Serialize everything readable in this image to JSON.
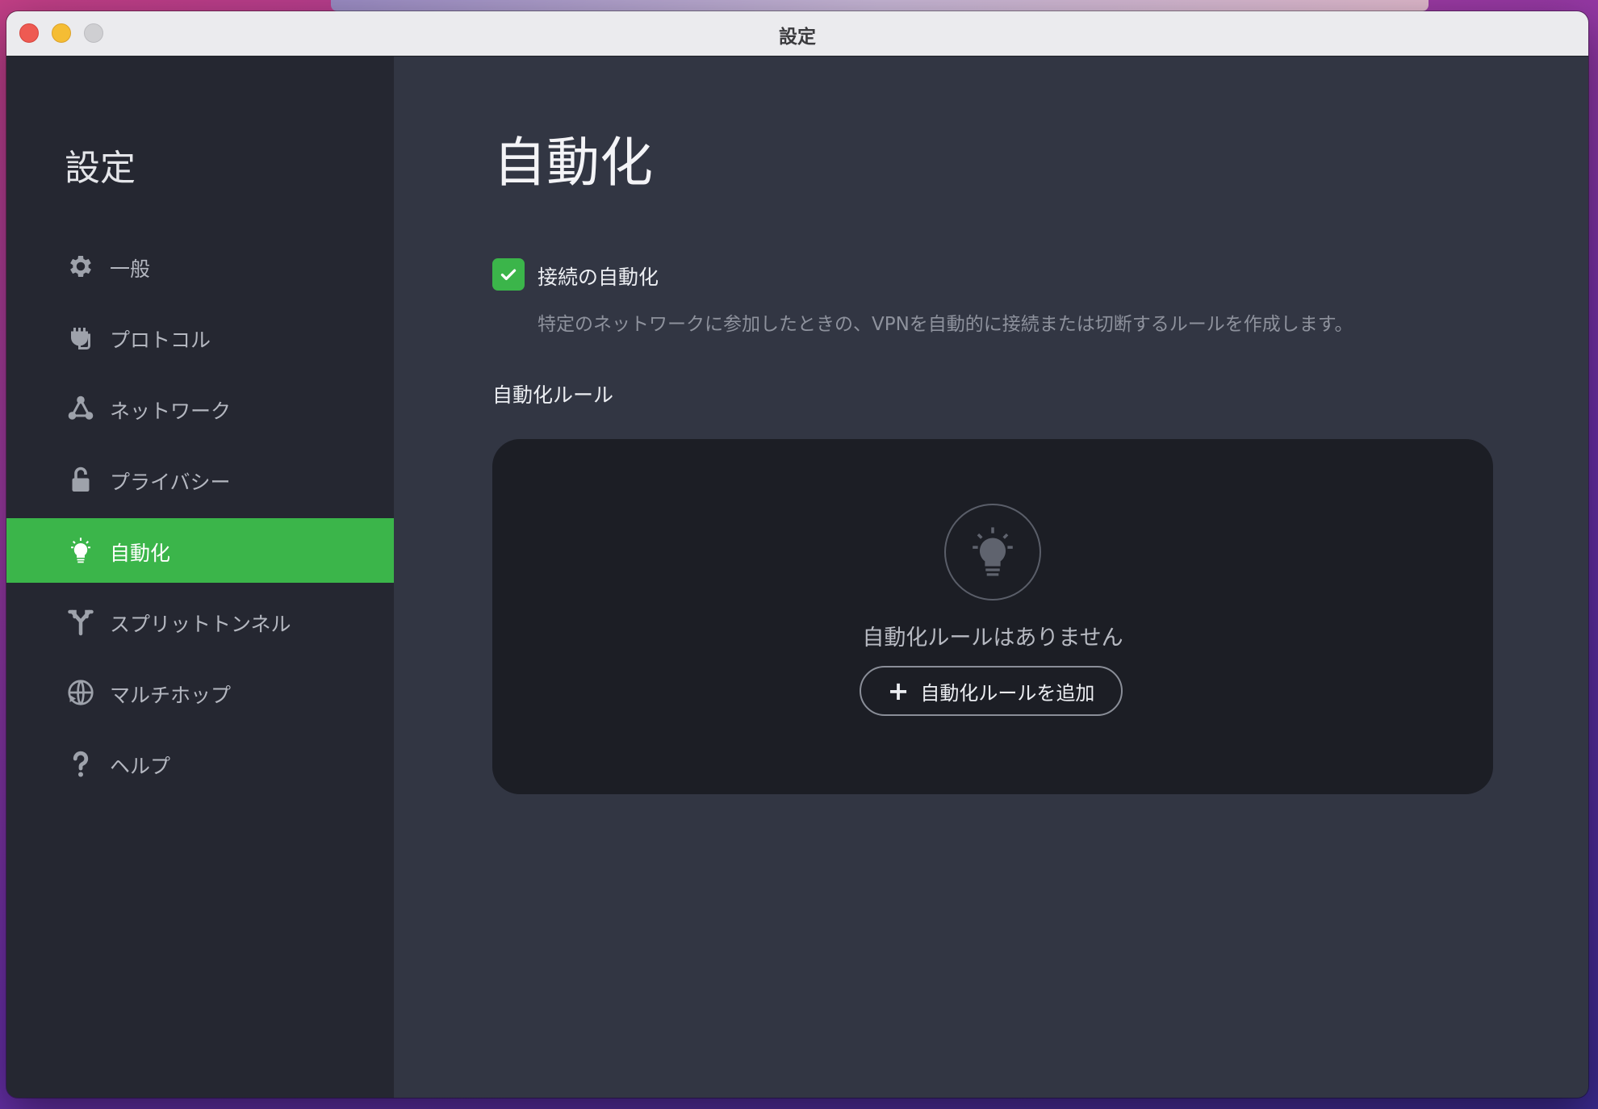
{
  "window": {
    "title": "設定"
  },
  "sidebar": {
    "title": "設定",
    "items": [
      {
        "label": "一般",
        "icon": "gear-icon",
        "active": false
      },
      {
        "label": "プロトコル",
        "icon": "plug-icon",
        "active": false
      },
      {
        "label": "ネットワーク",
        "icon": "network-nodes-icon",
        "active": false
      },
      {
        "label": "プライバシー",
        "icon": "lock-icon",
        "active": false
      },
      {
        "label": "自動化",
        "icon": "lightbulb-icon",
        "active": true
      },
      {
        "label": "スプリットトンネル",
        "icon": "split-arrow-icon",
        "active": false
      },
      {
        "label": "マルチホップ",
        "icon": "globe-icon",
        "active": false
      },
      {
        "label": "ヘルプ",
        "icon": "question-icon",
        "active": false
      }
    ]
  },
  "main": {
    "title": "自動化",
    "auto_connect": {
      "checked": true,
      "label": "接続の自動化",
      "description": "特定のネットワークに参加したときの、VPNを自動的に接続または切断するルールを作成します。"
    },
    "rules_section": {
      "label": "自動化ルール",
      "empty_text": "自動化ルールはありません",
      "add_button_label": "自動化ルールを追加",
      "add_icon": "plus-icon"
    }
  },
  "colors": {
    "accent": "#3bb54a",
    "sidebar_bg": "#252731",
    "main_bg": "#323643",
    "panel_bg": "#1c1e25"
  }
}
